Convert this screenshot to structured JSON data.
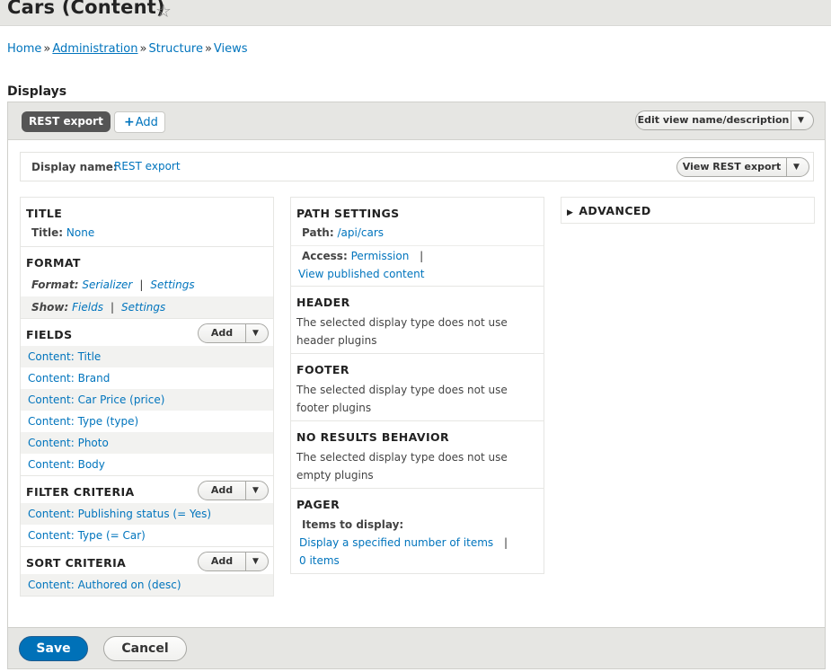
{
  "page": {
    "title": "Cars (Content)",
    "star_icon": "star-outline-icon"
  },
  "breadcrumb": [
    "Home",
    "Administration",
    "Structure",
    "Views"
  ],
  "section_heading": "Displays",
  "tabs": {
    "active": "REST export",
    "add_label": "Add"
  },
  "edit_view": "Edit view name/description",
  "display_name": {
    "label": "Display name:",
    "value": "REST export",
    "view_button": "View REST export"
  },
  "columns": {
    "first": {
      "title": {
        "heading": "TITLE",
        "label": "Title:",
        "value": "None"
      },
      "format": {
        "heading": "FORMAT",
        "format_label": "Format:",
        "format_value": "Serializer",
        "format_settings": "Settings",
        "show_label": "Show:",
        "show_value": "Fields",
        "show_settings": "Settings"
      },
      "fields": {
        "heading": "FIELDS",
        "add": "Add",
        "items": [
          "Content: Title",
          "Content: Brand",
          "Content: Car Price (price)",
          "Content: Type (type)",
          "Content: Photo",
          "Content: Body"
        ]
      },
      "filter": {
        "heading": "FILTER CRITERIA",
        "add": "Add",
        "items": [
          "Content: Publishing status (= Yes)",
          "Content: Type (= Car)"
        ]
      },
      "sort": {
        "heading": "SORT CRITERIA",
        "add": "Add",
        "items": [
          "Content: Authored on (desc)"
        ]
      }
    },
    "second": {
      "path": {
        "heading": "PATH SETTINGS",
        "path_label": "Path:",
        "path_value": "/api/cars",
        "access_label": "Access:",
        "access_value": "Permission",
        "access_pipe": "|",
        "access_detail": "View published content"
      },
      "header": {
        "heading": "HEADER",
        "text": "The selected display type does not use header plugins"
      },
      "footer": {
        "heading": "FOOTER",
        "text": "The selected display type does not use footer plugins"
      },
      "no_results": {
        "heading": "NO RESULTS BEHAVIOR",
        "text": "The selected display type does not use empty plugins"
      },
      "pager": {
        "heading": "PAGER",
        "items_label": "Items to display:",
        "items_value": "Display a specified number of items",
        "pipe": "|",
        "items_count": "0 items"
      }
    },
    "third": {
      "advanced": "ADVANCED"
    }
  },
  "actions": {
    "save": "Save",
    "cancel": "Cancel"
  },
  "colors": {
    "link": "#0074bd",
    "primary": "#0071b8",
    "tab_active": "#555555",
    "bar": "#e6e6e3"
  }
}
